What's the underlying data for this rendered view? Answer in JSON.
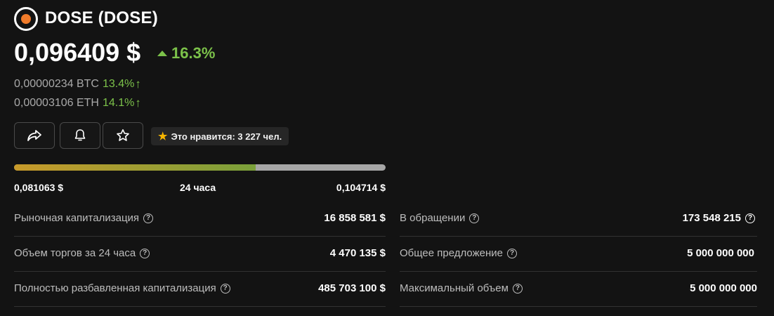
{
  "coin": {
    "name": "DOSE (DOSE)",
    "logo_icon": "dose-logo",
    "price": "0,096409 $",
    "change": "16.3%",
    "btc_value": "0,00000234 BTC",
    "btc_change": "13.4%",
    "eth_value": "0,00003106 ETH",
    "eth_change": "14.1%",
    "up_arrow": "↑"
  },
  "actions": {
    "share_icon": "share-icon",
    "bell_icon": "bell-icon",
    "star_icon": "star-icon",
    "likes_label": "Это нравится: 3 227 чел."
  },
  "range": {
    "low": "0,081063 $",
    "period": "24 часа",
    "high": "0,104714 $",
    "position_fraction": 0.65
  },
  "stats_left": [
    {
      "label": "Рыночная капитализация",
      "value": "16 858 581 $"
    },
    {
      "label": "Объем торгов за 24 часа",
      "value": "4 470 135 $"
    },
    {
      "label": "Полностью разбавленная капитализация",
      "value": "485 703 100 $"
    }
  ],
  "stats_right": [
    {
      "label": "В обращении",
      "value": "173 548 215"
    },
    {
      "label": "Общее предложение",
      "value": "5 000 000 000"
    },
    {
      "label": "Максимальный объем",
      "value": "5 000 000 000"
    }
  ],
  "help_glyph": "?",
  "colors": {
    "background": "#131313",
    "positive": "#7cc24a",
    "bar_gradient_start": "#c89a2a",
    "bar_gradient_end": "#7aa03a",
    "bar_track": "#a6a6a6",
    "star": "#f5b400",
    "logo_accent": "#f07b2a"
  }
}
